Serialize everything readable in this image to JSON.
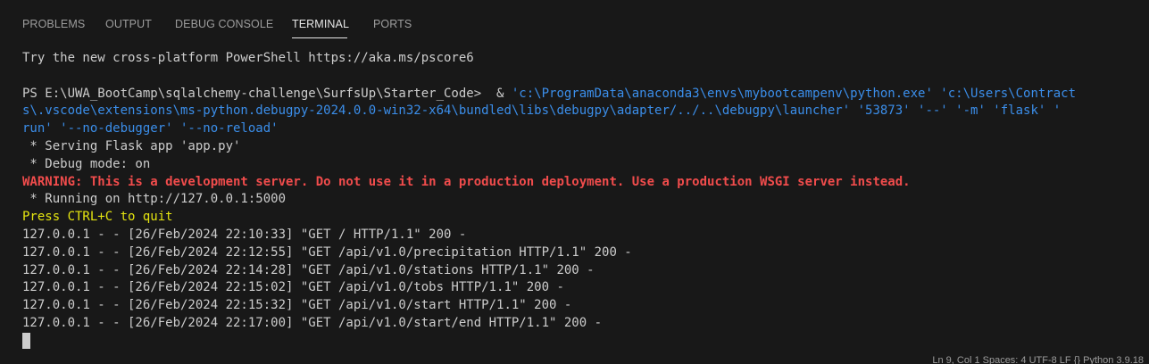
{
  "tabs": [
    {
      "label": "PROBLEMS",
      "active": false
    },
    {
      "label": "OUTPUT",
      "active": false
    },
    {
      "label": "DEBUG CONSOLE",
      "active": false
    },
    {
      "label": "TERMINAL",
      "active": true
    },
    {
      "label": "PORTS",
      "active": false
    }
  ],
  "terminal": {
    "notice": "Try the new cross-platform PowerShell https://aka.ms/pscore6",
    "prompt": "PS E:\\UWA_BootCamp\\sqlalchemy-challenge\\SurfsUp\\Starter_Code>  & ",
    "command_line1": "'c:\\ProgramData\\anaconda3\\envs\\mybootcampenv\\python.exe' 'c:\\Users\\Contract",
    "command_line2": "s\\.vscode\\extensions\\ms-python.debugpy-2024.0.0-win32-x64\\bundled\\libs\\debugpy\\adapter/../..\\debugpy\\launcher' '53873' '--' '-m' 'flask' '",
    "command_line3": "run' '--no-debugger' '--no-reload'",
    "serving": " * Serving Flask app 'app.py'",
    "debug_mode": " * Debug mode: on",
    "warning": "WARNING: This is a development server. Do not use it in a production deployment. Use a production WSGI server instead.",
    "running": " * Running on http://127.0.0.1:5000",
    "quit_hint": "Press CTRL+C to quit",
    "log": [
      "127.0.0.1 - - [26/Feb/2024 22:10:33] \"GET / HTTP/1.1\" 200 -",
      "127.0.0.1 - - [26/Feb/2024 22:12:55] \"GET /api/v1.0/precipitation HTTP/1.1\" 200 -",
      "127.0.0.1 - - [26/Feb/2024 22:14:28] \"GET /api/v1.0/stations HTTP/1.1\" 200 -",
      "127.0.0.1 - - [26/Feb/2024 22:15:02] \"GET /api/v1.0/tobs HTTP/1.1\" 200 -",
      "127.0.0.1 - - [26/Feb/2024 22:15:32] \"GET /api/v1.0/start HTTP/1.1\" 200 -",
      "127.0.0.1 - - [26/Feb/2024 22:17:00] \"GET /api/v1.0/start/end HTTP/1.1\" 200 -"
    ]
  },
  "statusbar": {
    "text": "Ln 9, Col 1   Spaces: 4   UTF-8   LF   {} Python   3.9.18"
  },
  "colors": {
    "background": "#181818",
    "text": "#cccccc",
    "string_blue": "#3b8eea",
    "warning_red": "#f14c4c",
    "quit_yellow": "#e5e510"
  }
}
